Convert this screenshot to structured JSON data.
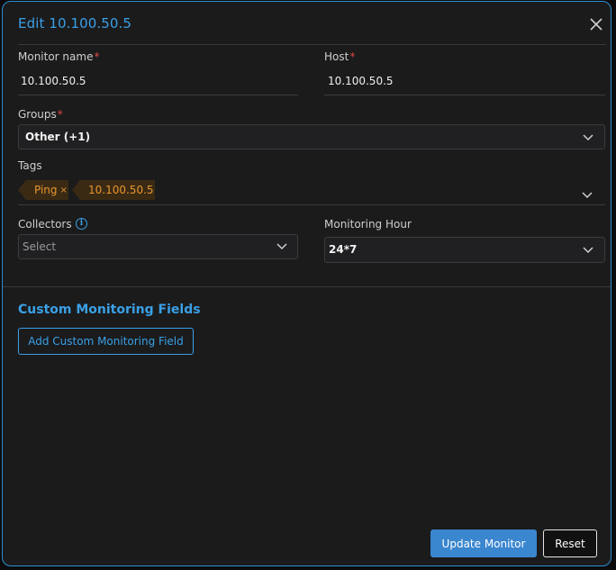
{
  "dialog": {
    "title": "Edit 10.100.50.5",
    "close_icon": "close-icon"
  },
  "form": {
    "monitor_name": {
      "label": "Monitor name",
      "required_mark": "*",
      "value": "10.100.50.5"
    },
    "host": {
      "label": "Host",
      "required_mark": "*",
      "value": "10.100.50.5"
    },
    "groups": {
      "label": "Groups",
      "required_mark": "*",
      "value": "Other (+1)"
    },
    "tags": {
      "label": "Tags",
      "items": [
        {
          "label": "Ping",
          "remove": "×"
        },
        {
          "label": "10.100.50.5",
          "remove": "×"
        }
      ]
    },
    "collectors": {
      "label": "Collectors",
      "info_icon": "i",
      "placeholder": "Select"
    },
    "monitoring_hour": {
      "label": "Monitoring Hour",
      "value": "24*7"
    }
  },
  "custom_fields": {
    "title": "Custom Monitoring Fields",
    "add_label": "Add Custom Monitoring Field"
  },
  "footer": {
    "update_label": "Update Monitor",
    "reset_label": "Reset"
  },
  "colors": {
    "accent": "#3aa0e6",
    "required": "#e04646",
    "tag_text": "#e7962e",
    "tag_bg": "#3a2a14",
    "primary_button": "#3a86cf"
  }
}
